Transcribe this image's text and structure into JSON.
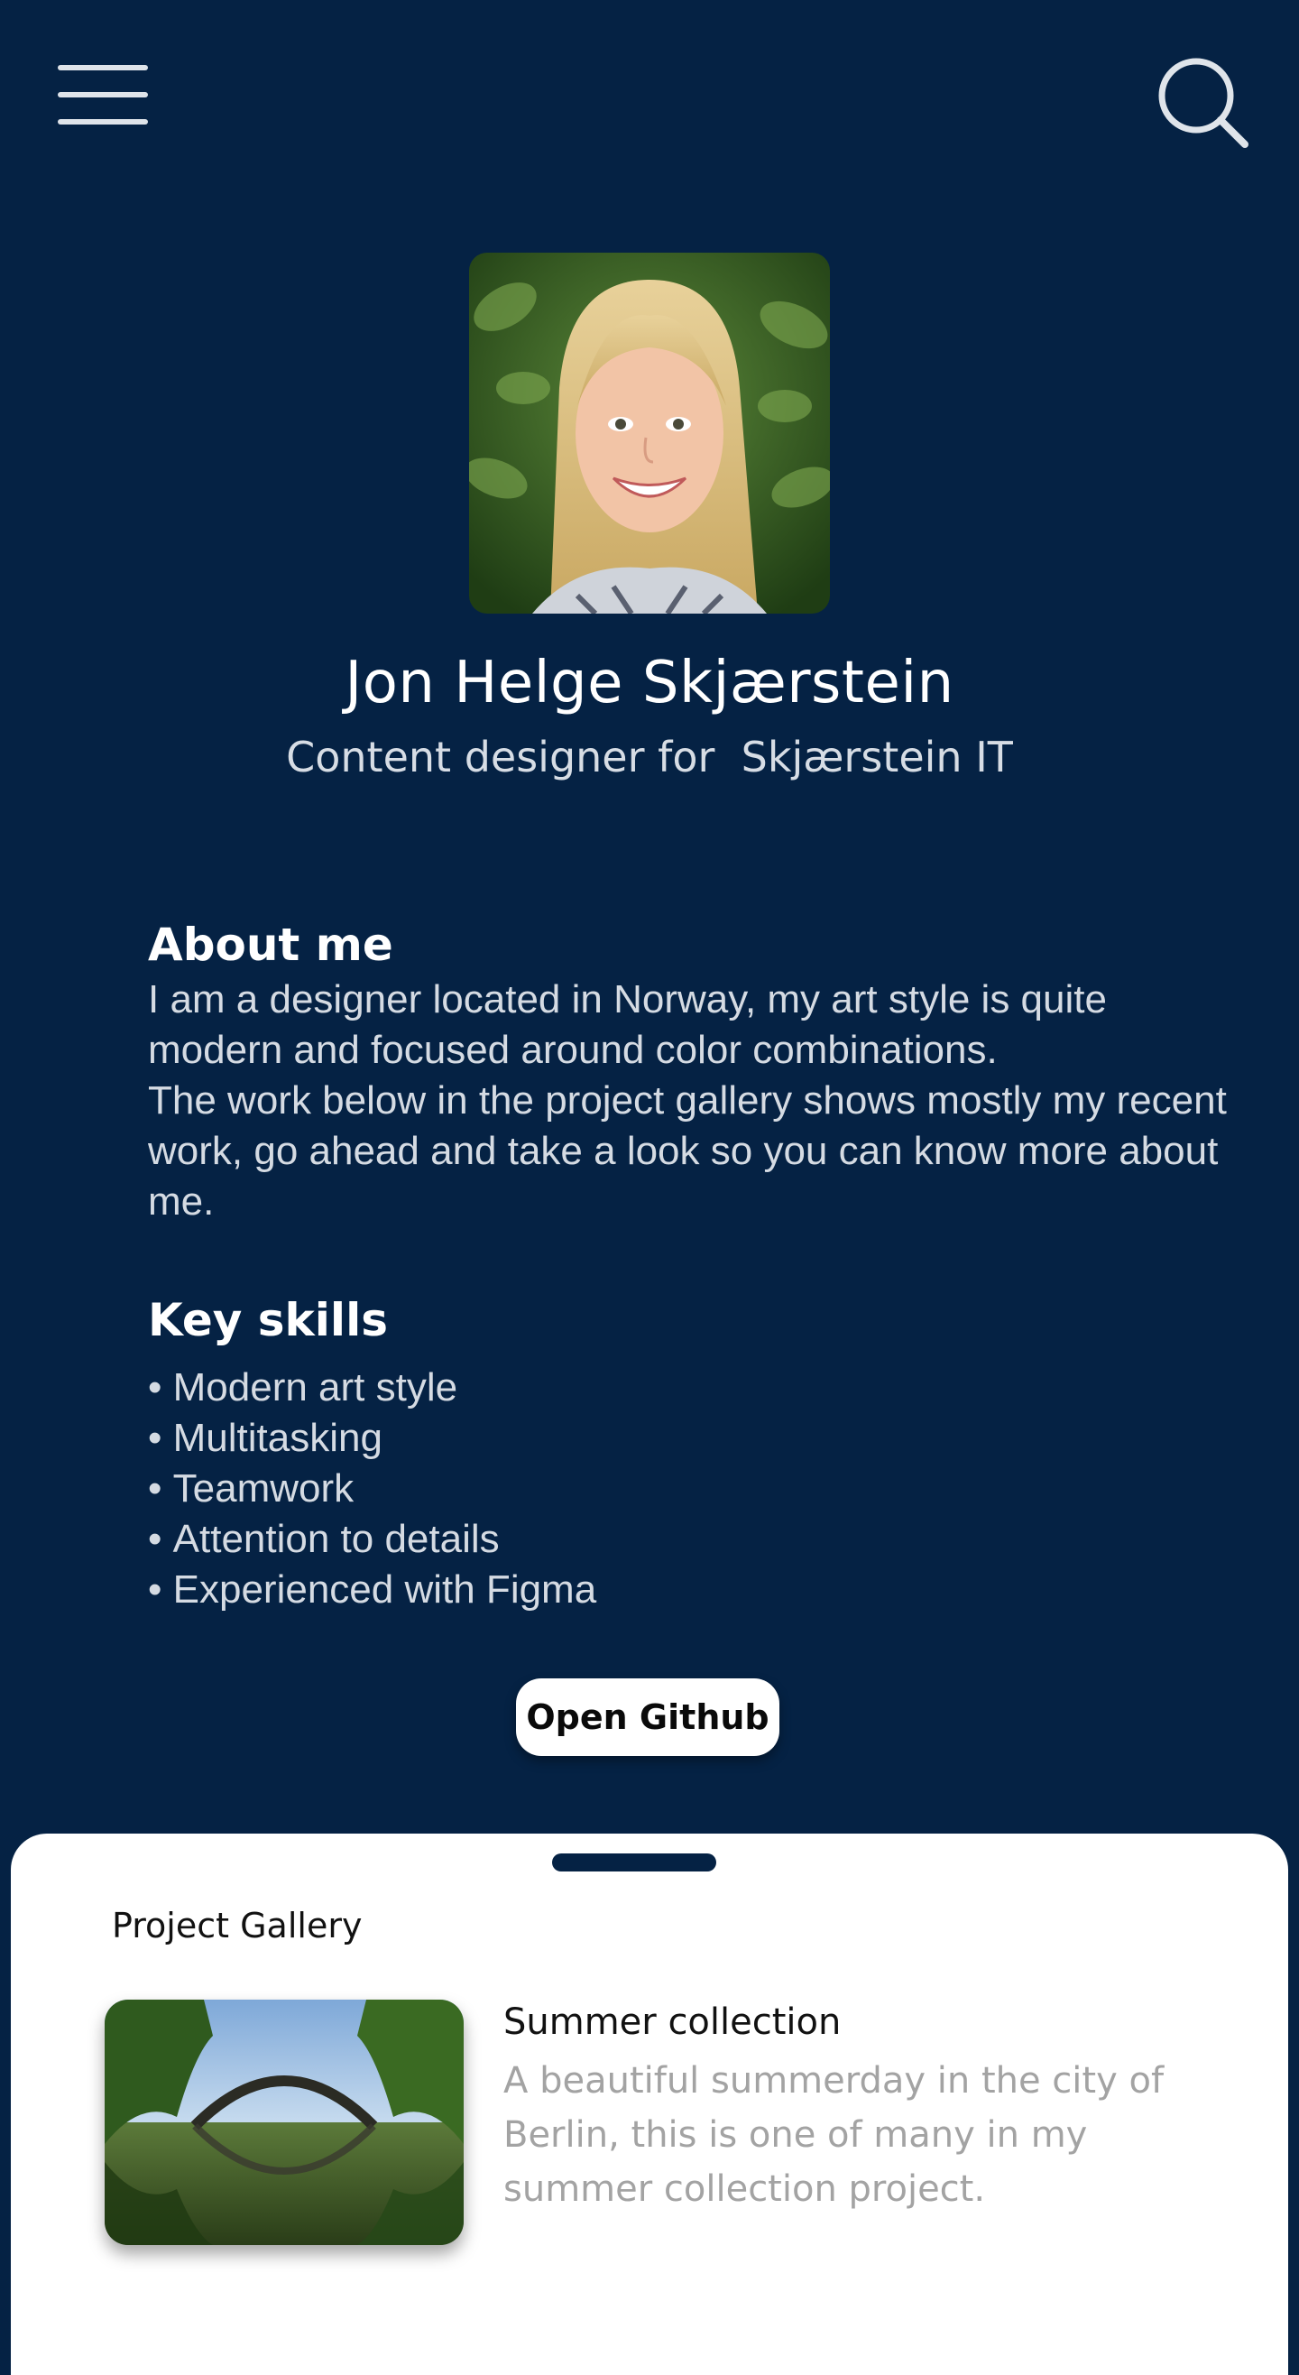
{
  "header": {
    "menu_icon": "hamburger-menu-icon",
    "search_icon": "search-icon"
  },
  "profile": {
    "name": "Jon Helge Skjærstein",
    "role": "Content designer for  Skjærstein IT"
  },
  "about": {
    "title": "About me",
    "text": "I am a designer located in Norway, my art style is quite modern and focused around color combinations.\nThe work below in the project gallery shows  mostly my recent work, go ahead and take a look so you can know more about me."
  },
  "skills": {
    "title": "Key skills",
    "items": [
      "Modern art style",
      "Multitasking",
      "Teamwork",
      "Attention to details",
      "Experienced with Figma"
    ]
  },
  "github_button": "Open Github",
  "gallery": {
    "title": "Project Gallery",
    "items": [
      {
        "title": "Summer collection",
        "description": "A beautiful summerday in the city of Berlin, this is one of many in my summer collection project."
      }
    ]
  },
  "colors": {
    "background": "#052244",
    "sheet": "#ffffff",
    "muted_text": "#a3a3a3"
  }
}
